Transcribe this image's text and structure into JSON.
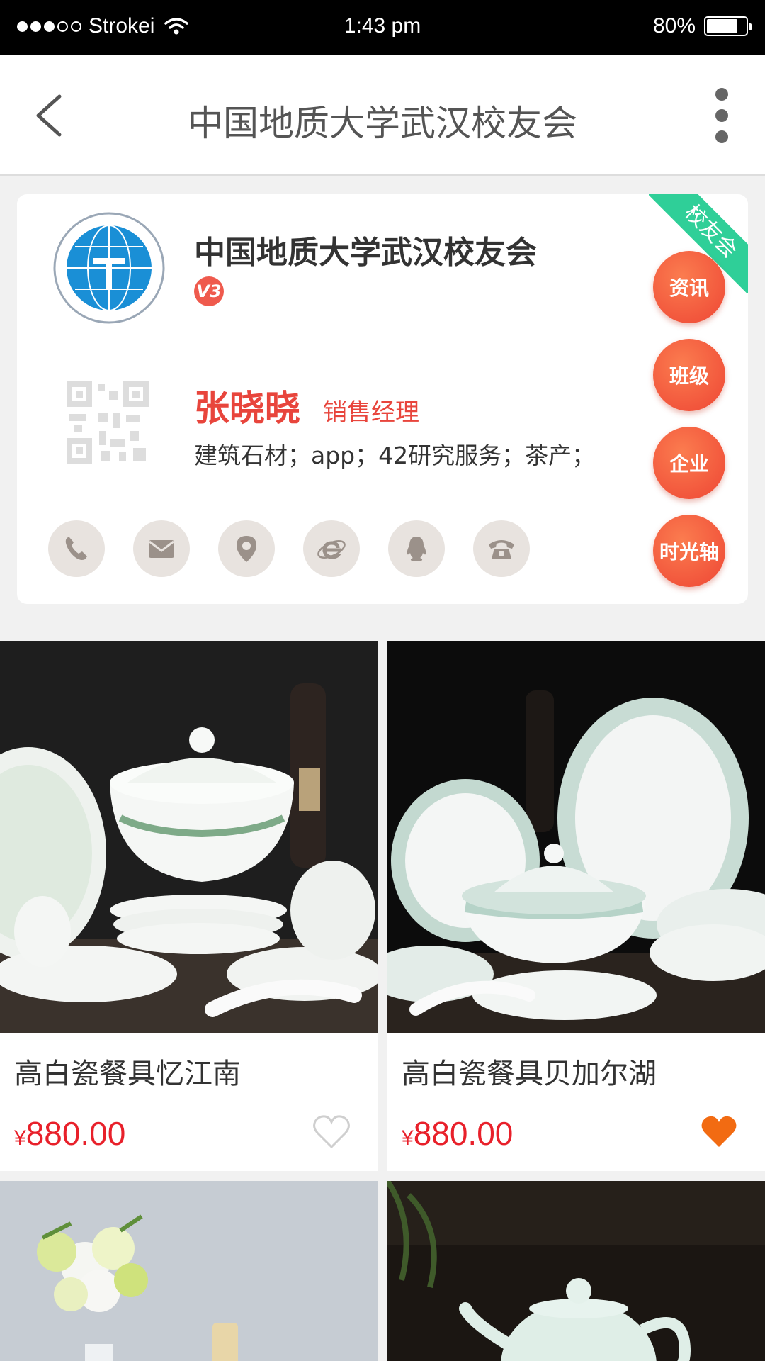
{
  "status_bar": {
    "carrier": "Strokei",
    "signal_dots": [
      true,
      true,
      true,
      false,
      false
    ],
    "time": "1:43 pm",
    "battery": "80%",
    "battery_level": 0.8
  },
  "nav": {
    "title": "中国地质大学武汉校友会"
  },
  "card": {
    "org_name": "中国地质大学武汉校友会",
    "level_badge": "V3",
    "ribbon": "校友会",
    "person_name": "张晓晓",
    "person_title": "销售经理",
    "tags": "建筑石材；app；42研究服务；茶产；",
    "contact_icons": [
      "phone-icon",
      "mail-icon",
      "location-icon",
      "browser-icon",
      "qq-icon",
      "telephone-icon"
    ],
    "side_buttons": [
      "资讯",
      "班级",
      "企业",
      "时光轴"
    ]
  },
  "products": [
    {
      "name": "高白瓷餐具忆江南",
      "currency": "¥",
      "price": "880.00",
      "favorited": false
    },
    {
      "name": "高白瓷餐具贝加尔湖",
      "currency": "¥",
      "price": "880.00",
      "favorited": true
    },
    {
      "name": "",
      "currency": "",
      "price": "",
      "favorited": false
    },
    {
      "name": "",
      "currency": "",
      "price": "",
      "favorited": false
    }
  ],
  "colors": {
    "accent_red": "#e8453c",
    "price_red": "#e8202a",
    "ribbon_green": "#2fcf98",
    "heart_orange": "#f26b12"
  }
}
